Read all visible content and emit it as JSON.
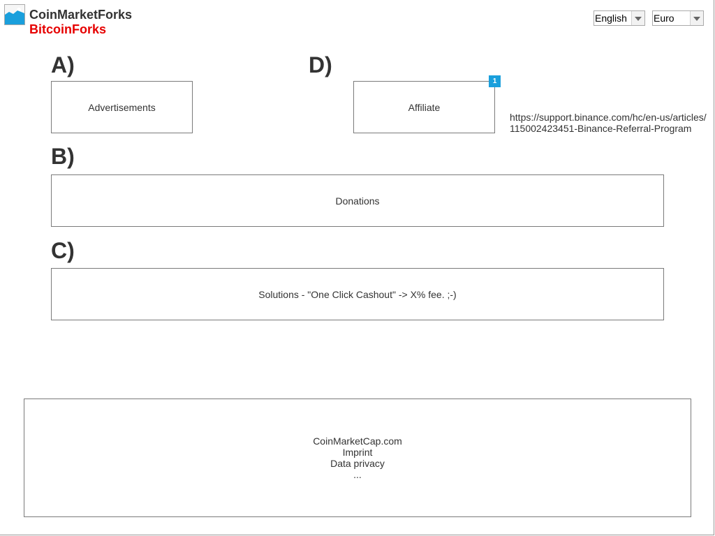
{
  "brand": {
    "title": "CoinMarketForks",
    "subtitle": "BitcoinForks",
    "logo_icon": "image-placeholder-icon",
    "subtitle_color": "#e60000"
  },
  "header": {
    "language_select": {
      "value": "English"
    },
    "currency_select": {
      "value": "Euro"
    }
  },
  "sections": {
    "a": {
      "label": "A)",
      "box_text": "Advertisements"
    },
    "b": {
      "label": "B)",
      "box_text": "Donations"
    },
    "c": {
      "label": "C)",
      "box_text": "Solutions - \"One Click Cashout\" -> X% fee. ;-)"
    },
    "d": {
      "label": "D)",
      "box_text": "Affiliate",
      "badge": "1",
      "badge_color": "#1a9fdc",
      "link_lines": [
        "https://support.binance.com/hc/en-us/articles/",
        "115002423451-Binance-Referral-Program"
      ]
    }
  },
  "footer": {
    "links": [
      "CoinMarketCap.com",
      "Imprint",
      "Data privacy",
      "..."
    ]
  }
}
